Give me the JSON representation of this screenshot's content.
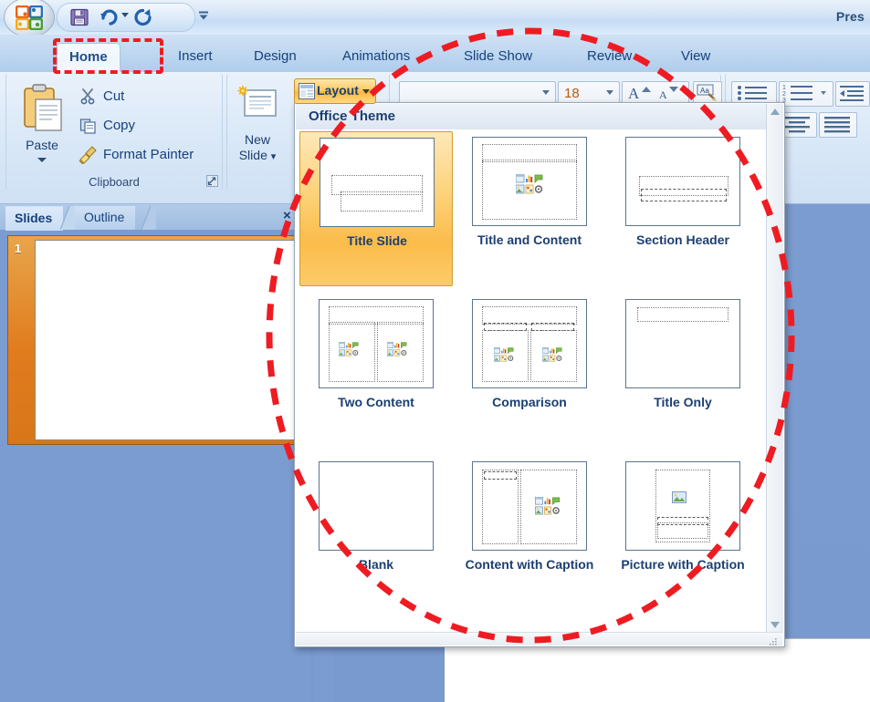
{
  "window": {
    "title": "Pres",
    "office_orb": "office-orb-icon"
  },
  "quick_access_toolbar": {
    "items": [
      {
        "name": "save-icon",
        "label": "Save"
      },
      {
        "name": "undo-icon",
        "label": "Undo"
      },
      {
        "name": "redo-icon",
        "label": "Redo"
      },
      {
        "name": "customize-qat-icon",
        "label": "Customize Quick Access Toolbar"
      }
    ]
  },
  "ribbon": {
    "tabs": [
      {
        "label": "Home",
        "active": true
      },
      {
        "label": "Insert",
        "active": false
      },
      {
        "label": "Design",
        "active": false
      },
      {
        "label": "Animations",
        "active": false
      },
      {
        "label": "Slide Show",
        "active": false
      },
      {
        "label": "Review",
        "active": false
      },
      {
        "label": "View",
        "active": false
      }
    ],
    "clipboard_group": {
      "label": "Clipboard",
      "paste_label": "Paste",
      "items": [
        {
          "label": "Cut",
          "icon": "scissors-icon"
        },
        {
          "label": "Copy",
          "icon": "copy-icon"
        },
        {
          "label": "Format Painter",
          "icon": "paintbrush-icon"
        }
      ],
      "dialog_launcher": "dialog-launcher-icon"
    },
    "slides_group": {
      "new_slide_line1": "New",
      "new_slide_line2": "Slide",
      "layout_button_label": "Layout"
    },
    "font_group": {
      "font_name_value": "",
      "font_size_value": "18",
      "grow_font": "grow-font-icon",
      "shrink_font": "shrink-font-icon",
      "clear_formatting": "clear-formatting-icon"
    },
    "paragraph_group": {
      "bullets": "bullets-icon",
      "numbering": "numbering-icon",
      "decrease_indent": "decrease-indent-icon",
      "align_left": "align-left-icon",
      "align_center": "align-center-icon",
      "justify": "justify-icon"
    }
  },
  "slide_pane": {
    "tabs": [
      {
        "label": "Slides",
        "active": true
      },
      {
        "label": "Outline",
        "active": false
      }
    ],
    "close_label": "×",
    "thumbnails": [
      {
        "number": "1"
      }
    ]
  },
  "layout_gallery": {
    "header": "Office Theme",
    "scroll_up": "scroll-up-arrow-icon",
    "scroll_down": "scroll-down-arrow-icon",
    "resize_grip": "resize-grip-icon",
    "items": [
      {
        "label": "Title Slide",
        "kind": "title-slide",
        "selected": true
      },
      {
        "label": "Title and Content",
        "kind": "title-and-content",
        "selected": false
      },
      {
        "label": "Section Header",
        "kind": "section-header",
        "selected": false
      },
      {
        "label": "Two Content",
        "kind": "two-content",
        "selected": false
      },
      {
        "label": "Comparison",
        "kind": "comparison",
        "selected": false
      },
      {
        "label": "Title Only",
        "kind": "title-only",
        "selected": false
      },
      {
        "label": "Blank",
        "kind": "blank",
        "selected": false
      },
      {
        "label": "Content with Caption",
        "kind": "content-with-caption",
        "selected": false
      },
      {
        "label": "Picture with Caption",
        "kind": "picture-with-caption",
        "selected": false
      }
    ]
  },
  "annotations": [
    {
      "name": "home-tab-highlight",
      "shape": "dashed-rectangle",
      "color": "#EE1C22"
    },
    {
      "name": "layout-gallery-highlight",
      "shape": "dashed-oval",
      "color": "#EE1C22"
    }
  ],
  "colors": {
    "annotation_red": "#EE1C22",
    "workspace_blue": "#7B9CD0",
    "ribbon_blue": "#DBE9F8",
    "accent_orange": "#FFBC3A",
    "text_navy": "#16407C"
  }
}
